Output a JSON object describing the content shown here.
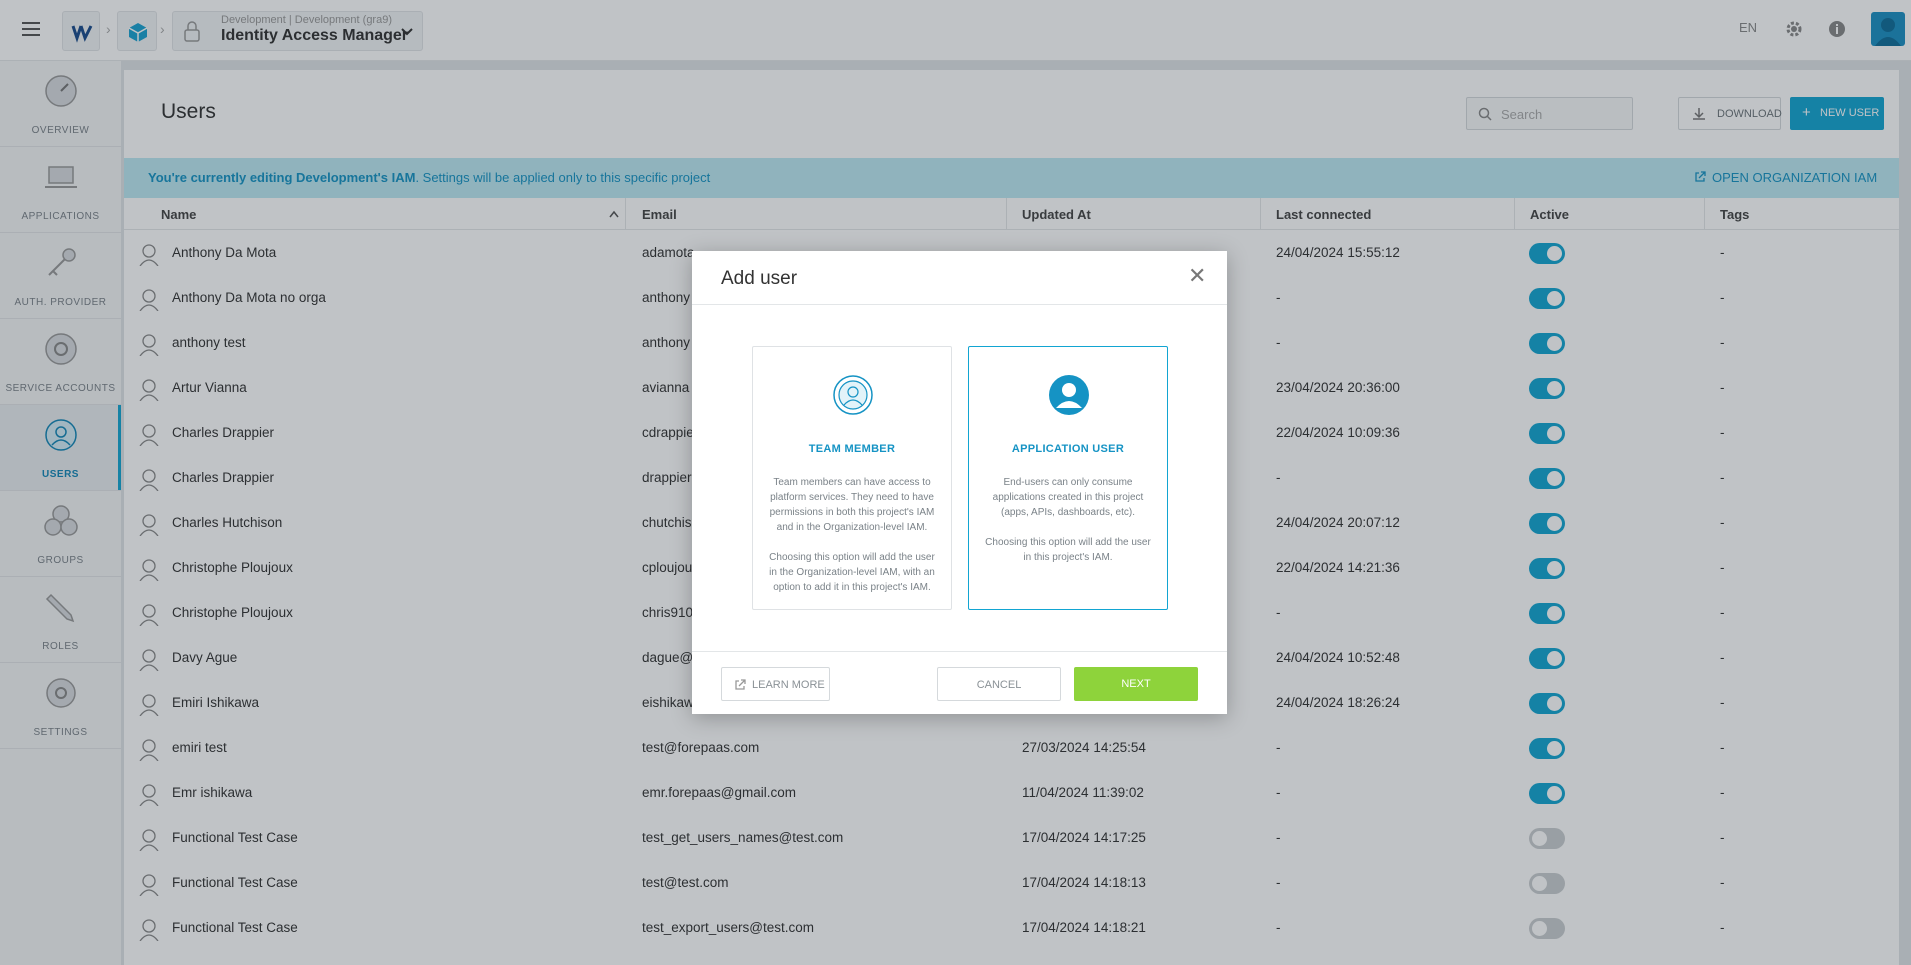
{
  "topbar": {
    "project_sub": "Development | Development (gra9)",
    "project_title": "Identity Access Manager",
    "lang": "EN"
  },
  "sidebar": {
    "items": [
      {
        "label": "OVERVIEW",
        "icon": "dashboard-gauge-icon"
      },
      {
        "label": "APPLICATIONS",
        "icon": "laptop-icon"
      },
      {
        "label": "AUTH. PROVIDER",
        "icon": "key-icon"
      },
      {
        "label": "SERVICE ACCOUNTS",
        "icon": "service-accounts-icon"
      },
      {
        "label": "USERS",
        "icon": "user-icon"
      },
      {
        "label": "GROUPS",
        "icon": "group-icon"
      },
      {
        "label": "ROLES",
        "icon": "pencil-icon"
      },
      {
        "label": "SETTINGS",
        "icon": "gear-icon"
      }
    ]
  },
  "main": {
    "title": "Users",
    "search_placeholder": "Search",
    "download_label": "DOWNLOAD",
    "new_user_label": "NEW USER",
    "banner_bold": "You're currently editing Development's IAM",
    "banner_rest": ". Settings will be applied only to this specific project",
    "open_org_label": "OPEN ORGANIZATION IAM",
    "columns": [
      "Name",
      "Email",
      "Updated At",
      "Last connected",
      "Active",
      "Tags"
    ],
    "rows": [
      {
        "name": "Anthony Da Mota",
        "email": "adamota",
        "updated": "",
        "last": "24/04/2024 15:55:12",
        "active": true,
        "tags": "-"
      },
      {
        "name": "Anthony Da Mota no orga",
        "email": "anthony",
        "updated": "",
        "last": "-",
        "active": true,
        "tags": "-"
      },
      {
        "name": "anthony test",
        "email": "anthony",
        "updated": "",
        "last": "-",
        "active": true,
        "tags": "-"
      },
      {
        "name": "Artur Vianna",
        "email": "avianna",
        "updated": "",
        "last": "23/04/2024 20:36:00",
        "active": true,
        "tags": "-"
      },
      {
        "name": "Charles Drappier",
        "email": "cdrappie",
        "updated": "",
        "last": "22/04/2024 10:09:36",
        "active": true,
        "tags": "-"
      },
      {
        "name": "Charles Drappier",
        "email": "drappier",
        "updated": "",
        "last": "-",
        "active": true,
        "tags": "-"
      },
      {
        "name": "Charles Hutchison",
        "email": "chutchis",
        "updated": "",
        "last": "24/04/2024 20:07:12",
        "active": true,
        "tags": "-"
      },
      {
        "name": "Christophe Ploujoux",
        "email": "cploujou",
        "updated": "",
        "last": "22/04/2024 14:21:36",
        "active": true,
        "tags": "-"
      },
      {
        "name": "Christophe Ploujoux",
        "email": "chris910",
        "updated": "",
        "last": "-",
        "active": true,
        "tags": "-"
      },
      {
        "name": "Davy Ague",
        "email": "dague@",
        "updated": "",
        "last": "24/04/2024 10:52:48",
        "active": true,
        "tags": "-"
      },
      {
        "name": "Emiri Ishikawa",
        "email": "eishikaw",
        "updated": "",
        "last": "24/04/2024 18:26:24",
        "active": true,
        "tags": "-"
      },
      {
        "name": "emiri test",
        "email": "test@forepaas.com",
        "updated": "27/03/2024 14:25:54",
        "last": "-",
        "active": true,
        "tags": "-"
      },
      {
        "name": "Emr ishikawa",
        "email": "emr.forepaas@gmail.com",
        "updated": "11/04/2024 11:39:02",
        "last": "-",
        "active": true,
        "tags": "-"
      },
      {
        "name": "Functional Test Case",
        "email": "test_get_users_names@test.com",
        "updated": "17/04/2024 14:17:25",
        "last": "-",
        "active": false,
        "tags": "-"
      },
      {
        "name": "Functional Test Case",
        "email": "test@test.com",
        "updated": "17/04/2024 14:18:13",
        "last": "-",
        "active": false,
        "tags": "-"
      },
      {
        "name": "Functional Test Case",
        "email": "test_export_users@test.com",
        "updated": "17/04/2024 14:18:21",
        "last": "-",
        "active": false,
        "tags": "-"
      }
    ]
  },
  "modal": {
    "title": "Add user",
    "options": [
      {
        "title": "TEAM MEMBER",
        "desc1": "Team members can have access to platform services. They need to have permissions in both this project's IAM and in the Organization-level IAM.",
        "desc2": "Choosing this option will add the user in the Organization-level IAM, with an option to add it in this project's IAM.",
        "selected": false
      },
      {
        "title": "APPLICATION USER",
        "desc1": "End-users can only consume applications created in this project (apps, APIs, dashboards, etc).",
        "desc2": "Choosing this option will add the user in this project's IAM.",
        "selected": true
      }
    ],
    "learn_more_label": "LEARN MORE",
    "cancel_label": "CANCEL",
    "next_label": "NEXT"
  },
  "colors": {
    "accent": "#12a5d2",
    "next_button": "#8ed33b",
    "banner_bg": "#bde9f3"
  }
}
